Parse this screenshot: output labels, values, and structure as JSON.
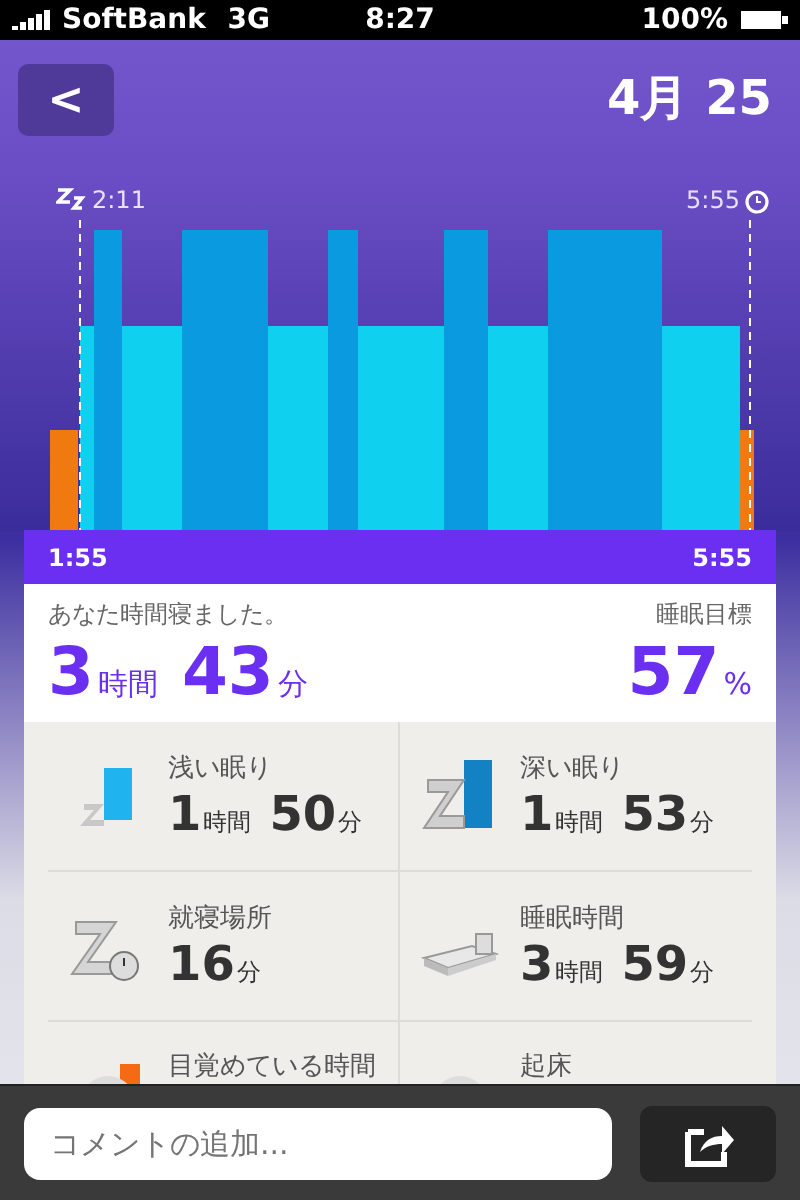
{
  "status_bar": {
    "carrier": "SoftBank",
    "network": "3G",
    "time": "8:27",
    "battery": "100%"
  },
  "header": {
    "back": "<",
    "date": "4月 25"
  },
  "sleep_graph": {
    "start_label": "2:11",
    "alarm_label": "5:55",
    "range_start": "1:55",
    "range_end": "5:55"
  },
  "summary": {
    "caption": "あなた時間寝ました。",
    "hours": "3",
    "hours_unit": "時間",
    "minutes": "43",
    "minutes_unit": "分",
    "goal_caption": "睡眠目標",
    "goal": "57",
    "goal_unit": "%"
  },
  "stats": [
    {
      "kind": "light",
      "label": "浅い眠り",
      "parts": [
        [
          "1",
          "時間"
        ],
        [
          "50",
          "分"
        ]
      ]
    },
    {
      "kind": "deep",
      "label": "深い眠り",
      "parts": [
        [
          "1",
          "時間"
        ],
        [
          "53",
          "分"
        ]
      ]
    },
    {
      "kind": "fall_asleep",
      "label": "就寝場所",
      "parts": [
        [
          "16",
          "分"
        ]
      ]
    },
    {
      "kind": "bed",
      "label": "睡眠時間",
      "parts": [
        [
          "3",
          "時間"
        ],
        [
          "59",
          "分"
        ]
      ]
    },
    {
      "kind": "awake",
      "label": "目覚めている時間"
    },
    {
      "kind": "wake",
      "label": "起床"
    }
  ],
  "comment": {
    "placeholder": "コメントの追加..."
  }
}
